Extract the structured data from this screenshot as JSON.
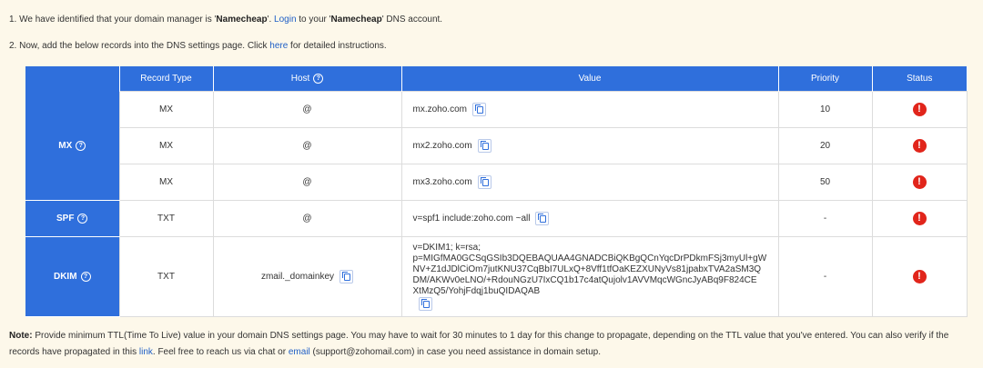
{
  "step1": {
    "pre": "1. We have identified that your domain manager is '",
    "manager": "Namecheap",
    "mid": "'. ",
    "login_link": "Login",
    "to": " to your '",
    "manager2": "Namecheap",
    "post": "' DNS account."
  },
  "step2": {
    "pre": "2. Now, add the below records into the DNS settings page. Click ",
    "link": "here",
    "post": " for detailed instructions."
  },
  "table": {
    "headers": [
      "",
      "Record Type",
      "Host",
      "Value",
      "Priority",
      "Status"
    ],
    "help_glyph": "?",
    "groups": [
      {
        "label": "MX"
      },
      {
        "label": "SPF"
      },
      {
        "label": "DKIM"
      }
    ],
    "rows": [
      {
        "type": "MX",
        "host": "@",
        "value": "mx.zoho.com",
        "priority": "10",
        "status": "!"
      },
      {
        "type": "MX",
        "host": "@",
        "value": "mx2.zoho.com",
        "priority": "20",
        "status": "!"
      },
      {
        "type": "MX",
        "host": "@",
        "value": "mx3.zoho.com",
        "priority": "50",
        "status": "!"
      },
      {
        "type": "TXT",
        "host": "@",
        "value": "v=spf1 include:zoho.com ~all",
        "priority": "-",
        "status": "!"
      },
      {
        "type": "TXT",
        "host": "zmail._domainkey",
        "value": "v=DKIM1; k=rsa;\np=MIGfMA0GCSqGSIb3DQEBAQUAA4GNADCBiQKBgQCnYqcDrPDkmFSj3myUl+gW\nNV+Z1dJDlCiOm7jutKNU37CqBbI7ULxQ+8Vff1tfOaKEZXUNyVs81jpabxTVA2aSM3Q\nDM/AKWv0eLNO/+RdouNGzU7IxCQ1b17c4atQujolv1AVVMqcWGncJyABq9F824CE\nXtMzQ5/YohjFdqj1buQIDAQAB",
        "priority": "-",
        "status": "!"
      }
    ]
  },
  "note": {
    "label": "Note:",
    "text1": " Provide minimum TTL(Time To Live) value in your domain DNS settings page. You may have to wait for 30 minutes to 1 day for this change to propagate, depending on the TTL value that you've entered. You can also verify if the records have propagated in this ",
    "link": "link",
    "text2": ". Feel free to reach us via chat or ",
    "email_link": "email",
    "text3": " (support@zohomail.com) in case you need assistance in domain setup."
  },
  "colors": {
    "accent": "#2f6fdc",
    "error": "#e1251b",
    "background": "#fdf8ea"
  },
  "icons": {
    "help": "help-circle-icon",
    "copy": "copy-icon",
    "status": "error-alert-icon"
  }
}
